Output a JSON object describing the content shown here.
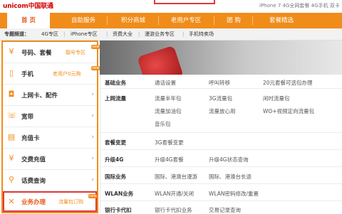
{
  "header": {
    "logo_text": "unicom中国联通",
    "promo_text": "iPhone 7  4G全网套餐  4G手机  双卡"
  },
  "nav": {
    "items": [
      "首  页",
      "自助服务",
      "积分商城",
      "老用户专区",
      "团  购",
      "套餐精选"
    ]
  },
  "channels": {
    "label": "专题频道：",
    "items": [
      "4G专区",
      "iPhone专区",
      "资费大全",
      "漫游业务专区",
      "手机特卖场"
    ]
  },
  "sidebar": {
    "items": [
      {
        "icon": "¥",
        "name": "号码、套餐",
        "tag": "靓号专区",
        "badge": "new"
      },
      {
        "icon": "▯",
        "name": "手机",
        "tag": "老用户0元购",
        "badge": "new"
      },
      {
        "icon": "◘",
        "name": "上网卡、配件",
        "tag": "",
        "badge": ""
      },
      {
        "icon": "☏",
        "name": "宽带",
        "tag": "",
        "badge": ""
      },
      {
        "icon": "▤",
        "name": "充值卡",
        "tag": "",
        "badge": ""
      },
      {
        "icon": "¥",
        "name": "交费充值",
        "tag": "",
        "badge": ""
      },
      {
        "icon": "⚲",
        "name": "话费查询",
        "tag": "",
        "badge": ""
      },
      {
        "icon": "✕",
        "name": "业务办理",
        "tag": "流量包订购",
        "badge": "new"
      }
    ]
  },
  "panel": {
    "rows": [
      {
        "label": "基础业务",
        "items": [
          "通话设置",
          "呼叫转移",
          "20元套餐可选包办理"
        ]
      },
      {
        "label": "上网流量",
        "items": [
          "流量半年包",
          "3G流量包",
          "闲时流量包",
          "流量加油包",
          "流量放心用",
          "WO+视频定向流量包",
          "音乐包"
        ]
      },
      {
        "label": "套餐变更",
        "items": [
          "3G套餐变更"
        ]
      },
      {
        "label": "升级4G",
        "items": [
          "升级4G套餐",
          "升级4G状态查询"
        ]
      },
      {
        "label": "国际业务",
        "items": [
          "国际、港澳台漫游",
          "国际、港澳台长途"
        ]
      },
      {
        "label": "WLAN业务",
        "items": [
          "WLAN开通/关闭",
          "WLAN密码修改/重置"
        ]
      },
      {
        "label": "银行卡代扣",
        "items": [
          "银行卡代扣业务",
          "交易记录查询"
        ]
      }
    ]
  }
}
